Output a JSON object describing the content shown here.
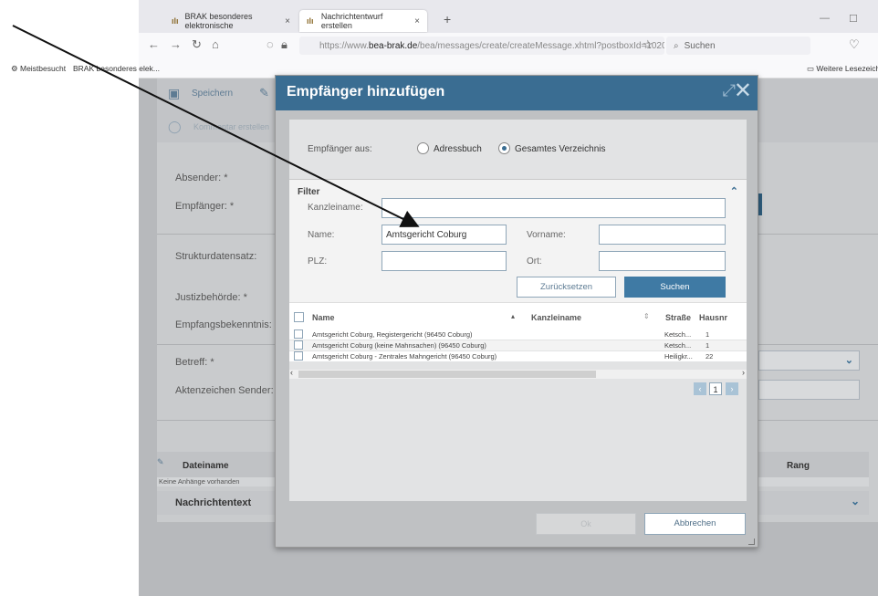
{
  "browser": {
    "tabs": [
      {
        "label": "BRAK besonderes elektronische"
      },
      {
        "label": "Nachrichtentwurf erstellen"
      }
    ],
    "url_prefix": "https://www.",
    "url_domain": "bea-brak.de",
    "url_path": "/bea/messages/create/createMessage.xhtml?postboxId=1020",
    "search_placeholder": "Suchen",
    "bookmarks": {
      "meistbesucht": "Meistbesucht",
      "brak": "BRAK besonderes elek...",
      "weitere": "Weitere Lesezeich"
    }
  },
  "page": {
    "save_label": "Speichern",
    "comment_label": "Kommentar erstellen",
    "labels": {
      "absender": "Absender: *",
      "empfaenger": "Empfänger: *",
      "strukturdatensatz": "Strukturdatensatz:",
      "justizbehoerde": "Justizbehörde: *",
      "empfangsbekenntnis": "Empfangsbekenntnis:",
      "betreff": "Betreff: *",
      "aktenzeichen": "Aktenzeichen Sender:"
    },
    "attachments": {
      "col_dateiname": "Dateiname",
      "col_rang": "Rang",
      "empty": "Keine Anhänge vorhanden"
    },
    "nachrichtentext": "Nachrichtentext"
  },
  "modal": {
    "title": "Empfänger hinzufügen",
    "source_label": "Empfänger aus:",
    "source_options": [
      "Adressbuch",
      "Gesamtes Verzeichnis"
    ],
    "source_selected": "Gesamtes Verzeichnis",
    "filter": {
      "title": "Filter",
      "kanzleiname_label": "Kanzleiname:",
      "kanzleiname_value": "",
      "name_label": "Name:",
      "name_value": "Amtsgericht Coburg",
      "vorname_label": "Vorname:",
      "vorname_value": "",
      "plz_label": "PLZ:",
      "plz_value": "",
      "ort_label": "Ort:",
      "ort_value": "",
      "reset_label": "Zurücksetzen",
      "search_label": "Suchen"
    },
    "results": {
      "columns": [
        "Name",
        "Kanzleiname",
        "Straße",
        "Hausnr"
      ],
      "rows": [
        {
          "name": "Amtsgericht Coburg, Registergericht (96450 Coburg)",
          "street": "Ketsch...",
          "nr": "1"
        },
        {
          "name": "Amtsgericht Coburg (keine Mahnsachen) (96450 Coburg)",
          "street": "Ketsch...",
          "nr": "1"
        },
        {
          "name": "Amtsgericht Coburg - Zentrales Mahngericht (96450 Coburg)",
          "street": "Heiligkr...",
          "nr": "22"
        }
      ],
      "page": "1"
    },
    "ok_label": "Ok",
    "cancel_label": "Abbrechen"
  },
  "colors": {
    "header": "#3a6d92",
    "primary_button": "#3f7aa4"
  }
}
